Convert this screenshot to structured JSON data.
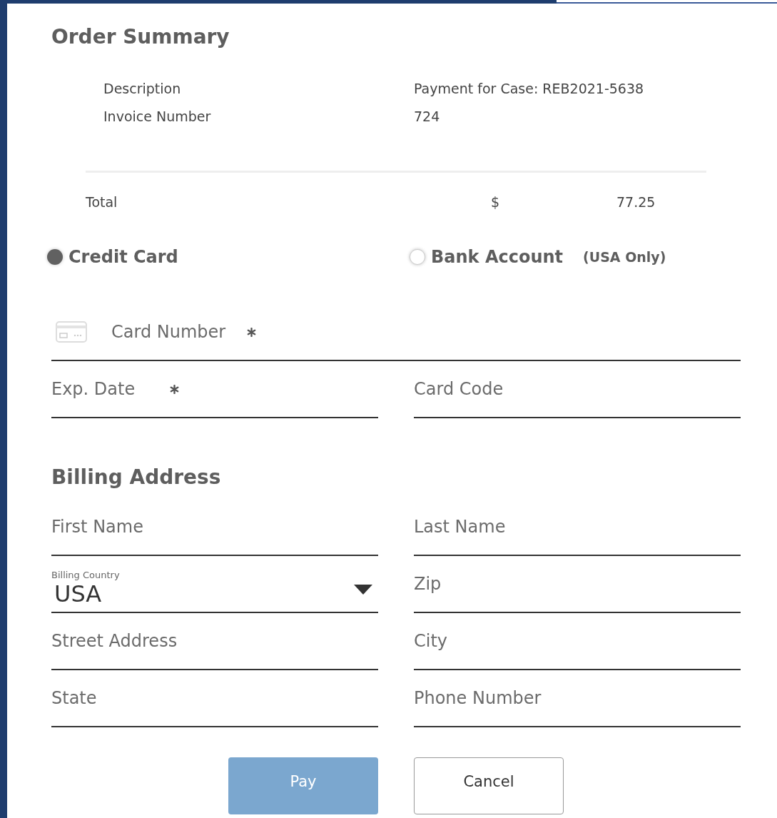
{
  "order_summary": {
    "title": "Order Summary",
    "items": [
      {
        "label": "Description",
        "value": "Payment for Case: REB2021-5638"
      },
      {
        "label": "Invoice Number",
        "value": "724"
      }
    ],
    "total": {
      "label": "Total",
      "currency": "$",
      "amount": "77.25"
    }
  },
  "payment_methods": [
    {
      "label": "Credit Card",
      "selected": true
    },
    {
      "label": "Bank Account",
      "note": "(USA Only)",
      "selected": false
    }
  ],
  "card_fields": [
    {
      "placeholder": "Card Number",
      "required": true,
      "kind": "card"
    },
    {
      "placeholder": "Exp. Date",
      "required": true,
      "kind": "text"
    },
    {
      "placeholder": "Card Code",
      "kind": "text"
    }
  ],
  "billing_address": {
    "title": "Billing Address",
    "fields": [
      {
        "placeholder": "First Name",
        "kind": "text"
      },
      {
        "placeholder": "Last Name",
        "kind": "text"
      },
      {
        "label": "Billing Country",
        "value": "USA",
        "kind": "select"
      },
      {
        "placeholder": "Zip",
        "kind": "text"
      },
      {
        "placeholder": "Street Address",
        "kind": "text"
      },
      {
        "placeholder": "City",
        "kind": "text"
      },
      {
        "placeholder": "State",
        "kind": "text"
      },
      {
        "placeholder": "Phone Number",
        "kind": "text"
      }
    ]
  },
  "buttons": [
    {
      "label": "Pay",
      "disabled": true,
      "kind": "primary"
    },
    {
      "label": "Cancel",
      "disabled": false,
      "kind": "secondary"
    }
  ]
}
